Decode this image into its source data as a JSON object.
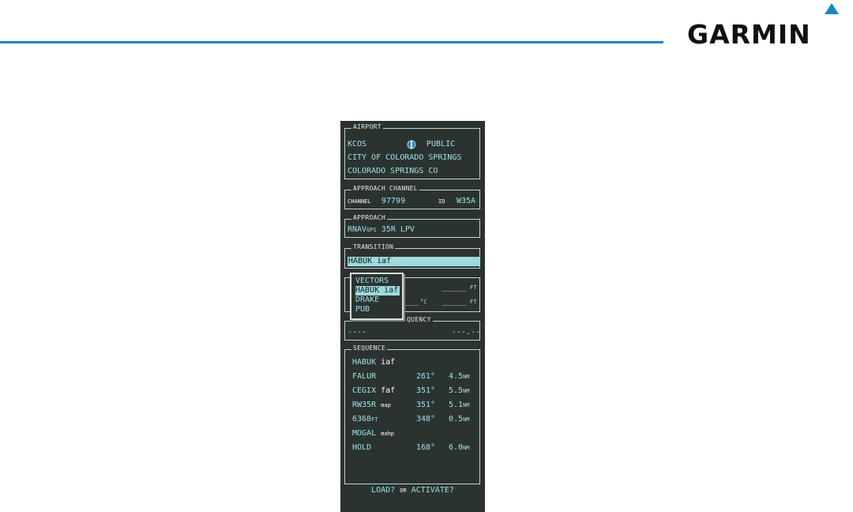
{
  "logo": {
    "text": "GARMIN"
  },
  "airport": {
    "title": "AIRPORT",
    "ident": "KCOS",
    "type": "PUBLIC",
    "city": "CITY OF COLORADO SPRINGS",
    "location": "COLORADO SPRINGS CO"
  },
  "approach_channel": {
    "title": "APPROACH CHANNEL",
    "channel_label": "CHANNEL",
    "channel": "97799",
    "id_label": "ID",
    "id": "W35A"
  },
  "approach": {
    "title": "APPROACH",
    "name_main": "RNAV",
    "name_sub": "GPS",
    "name_rest": "35R LPV"
  },
  "transition": {
    "title": "TRANSITION",
    "selected": "HABUK iaf"
  },
  "dropdown": {
    "options": [
      "VECTORS",
      "HABUK iaf",
      "DRAKE",
      "PUB"
    ],
    "selected_index": 1
  },
  "minimums": {
    "dashes1": "_____",
    "ft1": "FT",
    "temp_dashes": "___",
    "temp_unit": "°C",
    "dashes2": "_____",
    "ft2": "FT"
  },
  "frequency": {
    "title_partial": "QUENCY",
    "left": "----",
    "right": "---.--"
  },
  "sequence": {
    "title": "SEQUENCE",
    "rows": [
      {
        "name": "HABUK",
        "tag": "iaf",
        "course": "",
        "dist": "",
        "unit": ""
      },
      {
        "name": "FALUR",
        "tag": "",
        "course": "261°",
        "dist": "4.5",
        "unit": "NM"
      },
      {
        "name": "CEGIX",
        "tag": "faf",
        "course": "351°",
        "dist": "5.5",
        "unit": "NM"
      },
      {
        "name": "RW35R",
        "tag": "map",
        "course": "351°",
        "dist": "5.1",
        "unit": "NM"
      },
      {
        "name": "6368",
        "tag": "FT",
        "course": "348°",
        "dist": "0.5",
        "unit": "NM"
      },
      {
        "name": "MOGAL",
        "tag": "mahp",
        "course": "",
        "dist": "",
        "unit": ""
      },
      {
        "name": "HOLD",
        "tag": "",
        "course": "168°",
        "dist": "6.0",
        "unit": "NM"
      }
    ]
  },
  "footer": {
    "load": "LOAD?",
    "or": "OR",
    "activate": "ACTIVATE?"
  },
  "colors": {
    "accent": "#1a85c6",
    "panel_bg": "#2b3331",
    "cyan_text": "#9fe0e6",
    "highlight": "#9fd9dc"
  }
}
